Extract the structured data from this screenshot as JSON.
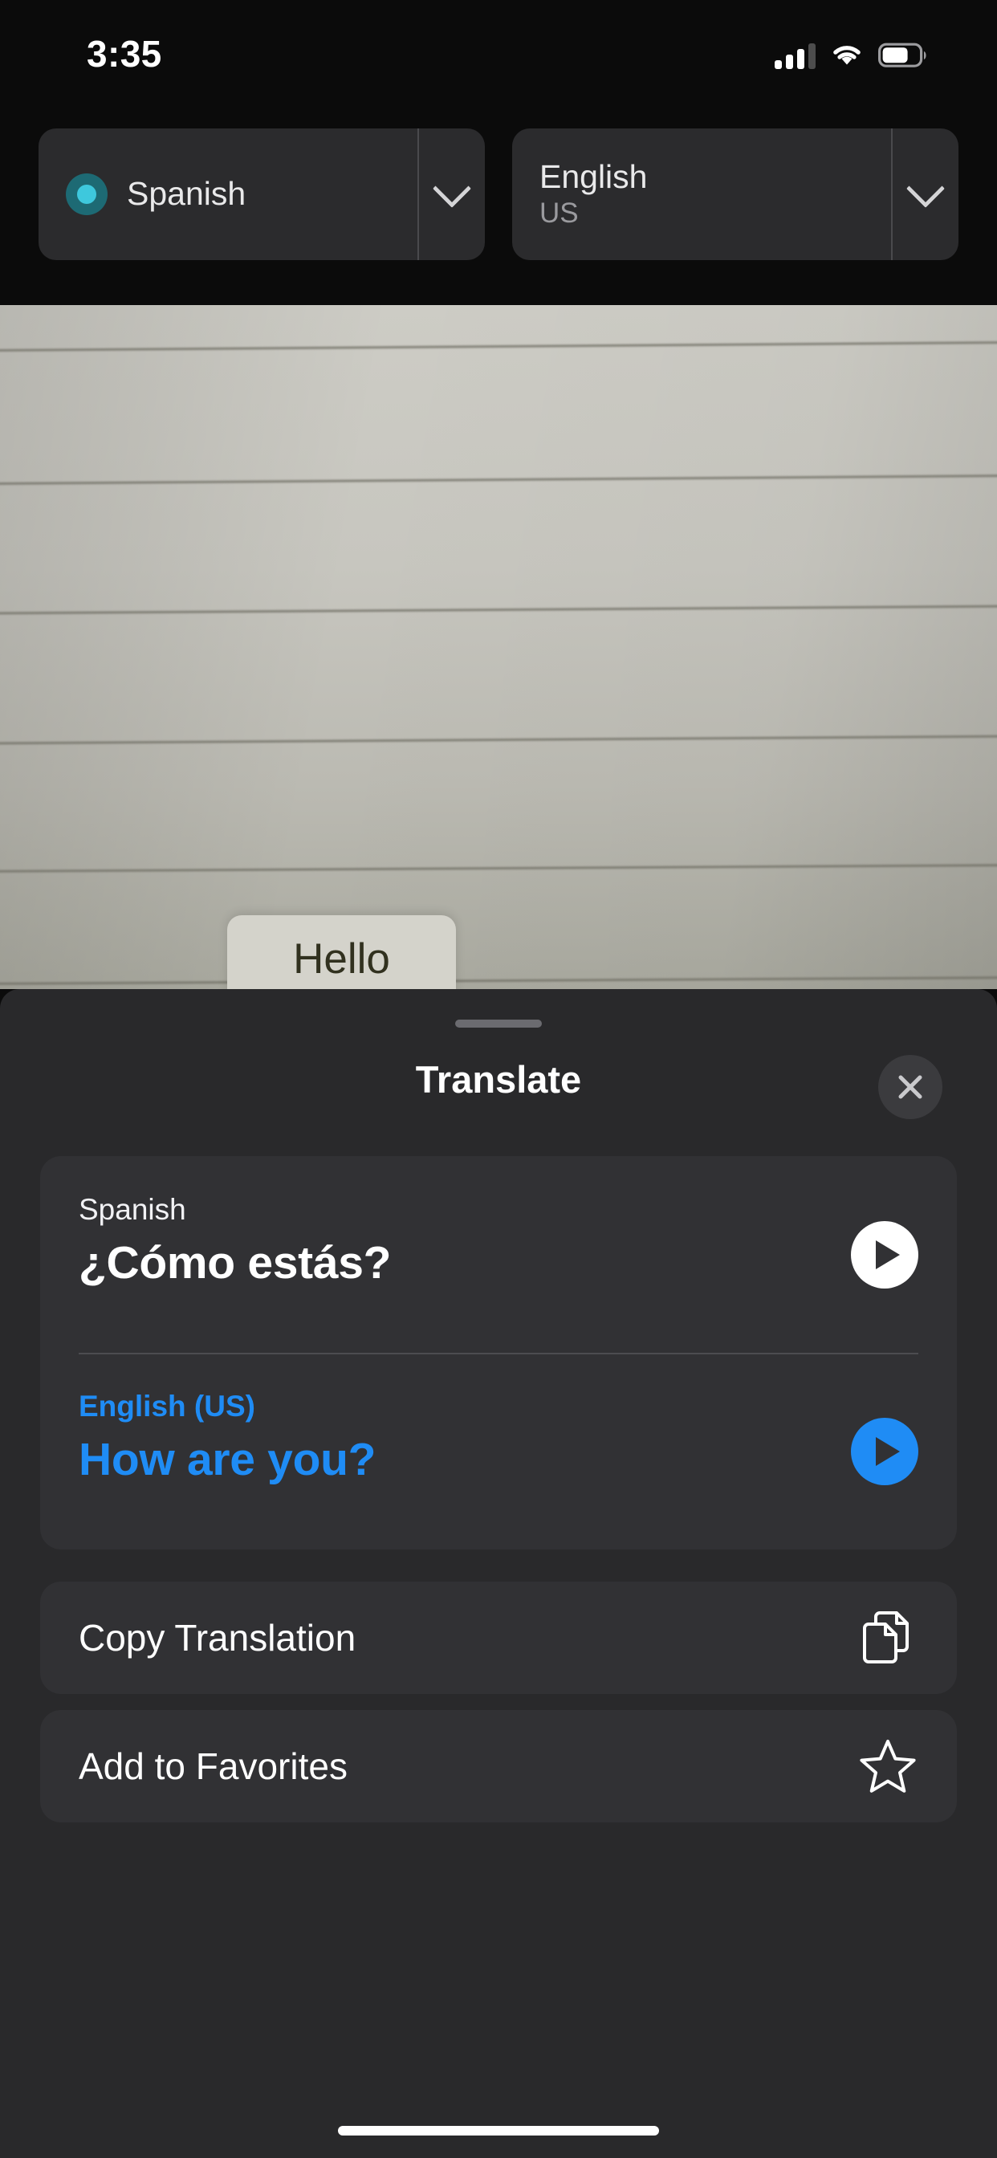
{
  "status_bar": {
    "time": "3:35",
    "cellular_icon": "cellular-signal-icon",
    "cellular_bars_filled": 3,
    "cellular_bars_total": 4,
    "wifi_icon": "wifi-icon",
    "battery_icon": "battery-icon",
    "battery_level_percent": 65
  },
  "language_bar": {
    "source": {
      "name": "Spanish",
      "sub": "",
      "active_indicator": "listening-dot-icon",
      "indicator_color": "#3ec8dd",
      "chevron_icon": "chevron-down-icon"
    },
    "target": {
      "name": "English",
      "sub": "US",
      "chevron_icon": "chevron-down-icon"
    }
  },
  "camera": {
    "detected_text_bubble": "Hello"
  },
  "sheet": {
    "title": "Translate",
    "grabber": "sheet-drag-handle",
    "close_icon": "close-icon",
    "translation": {
      "source_label": "Spanish",
      "source_text": "¿Cómo estás?",
      "source_play_icon": "play-icon",
      "target_label": "English (US)",
      "target_text": "How are you?",
      "target_play_icon": "play-icon",
      "accent_color": "#1f8cf5"
    },
    "actions": [
      {
        "label": "Copy Translation",
        "icon": "copy-documents-icon"
      },
      {
        "label": "Add to Favorites",
        "icon": "star-outline-icon"
      }
    ]
  },
  "home_indicator": "home-indicator"
}
